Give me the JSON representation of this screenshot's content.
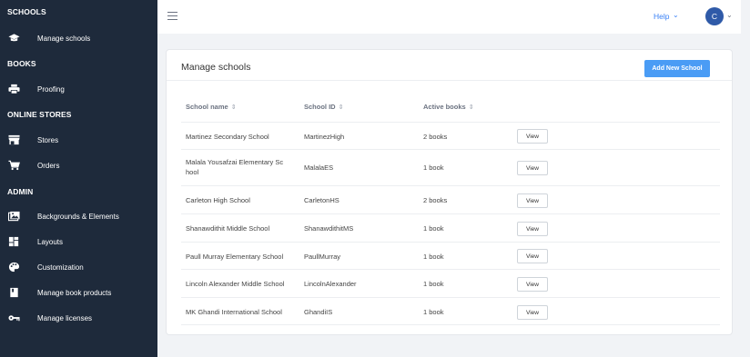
{
  "sidebar": {
    "sections": {
      "schools": "SCHOOLS",
      "books": "BOOKS",
      "online_stores": "ONLINE STORES",
      "admin": "ADMIN"
    },
    "items": {
      "manage_schools": "Manage schools",
      "proofing": "Proofing",
      "stores": "Stores",
      "orders": "Orders",
      "backgrounds": "Backgrounds & Elements",
      "layouts": "Layouts",
      "customization": "Customization",
      "manage_book_products": "Manage book products",
      "manage_licenses": "Manage licenses"
    }
  },
  "topbar": {
    "help_label": "Help",
    "avatar_initial": "C"
  },
  "main": {
    "title": "Manage schools",
    "add_button": "Add New School",
    "columns": {
      "school_name": "School name",
      "school_id": "School ID",
      "active_books": "Active books"
    },
    "view_label": "View",
    "rows": [
      {
        "name": "Martinez Secondary School",
        "id": "MartinezHigh",
        "books": "2 books"
      },
      {
        "name_line1": "Malala Yousafzai Elementary Sc",
        "name_line2": "hool",
        "id": "MalalaES",
        "books": "1 book"
      },
      {
        "name": "Carleton High School",
        "id": "CarletonHS",
        "books": "2 books"
      },
      {
        "name": "Shanawdithit Middle School",
        "id": "ShanawdithitMS",
        "books": "1 book"
      },
      {
        "name": "Paull Murray Elementary School",
        "id": "PaullMurray",
        "books": "1 book"
      },
      {
        "name": "Lincoln Alexander Middle School",
        "id": "LincolnAlexander",
        "books": "1 book"
      },
      {
        "name": "MK Ghandi International School",
        "id": "GhandiIS",
        "books": "1 book"
      }
    ]
  },
  "colors": {
    "sidebar_bg": "#1e2a3b",
    "accent": "#4a9cf5",
    "avatar": "#2f5aa8"
  }
}
